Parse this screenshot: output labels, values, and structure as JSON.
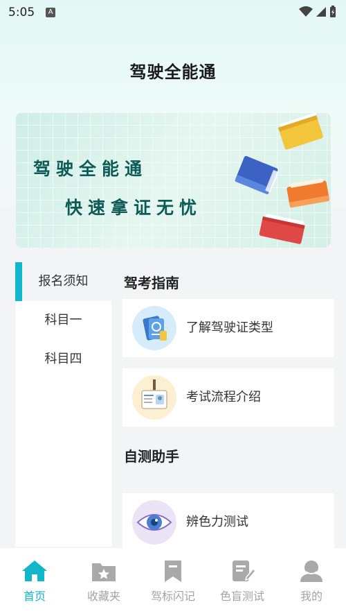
{
  "status_bar": {
    "time": "5:05",
    "notif_glyph": "A"
  },
  "header": {
    "title": "驾驶全能通"
  },
  "banner": {
    "line1": "驾驶全能通",
    "line2": "快速拿证无忧"
  },
  "categories": [
    {
      "label": "报名须知",
      "active": true
    },
    {
      "label": "科目一",
      "active": false
    },
    {
      "label": "科目四",
      "active": false
    }
  ],
  "sections": [
    {
      "title": "驾考指南",
      "cards": [
        {
          "label": "了解驾驶证类型",
          "icon": "passport-icon"
        },
        {
          "label": "考试流程介绍",
          "icon": "id-badge-icon"
        }
      ]
    },
    {
      "title": "自测助手",
      "cards": [
        {
          "label": "辨色力测试",
          "icon": "eye-icon"
        }
      ]
    }
  ],
  "tabs": [
    {
      "label": "首页",
      "icon": "home-icon",
      "active": true
    },
    {
      "label": "收藏夹",
      "icon": "folder-star-icon",
      "active": false
    },
    {
      "label": "驾标闪记",
      "icon": "bookmark-icon",
      "active": false
    },
    {
      "label": "色盲测试",
      "icon": "edit-doc-icon",
      "active": false
    },
    {
      "label": "我的",
      "icon": "user-icon",
      "active": false
    }
  ],
  "colors": {
    "accent": "#11b7c8",
    "inactive_tab": "#a3a3a3",
    "banner_text": "#0d5b56"
  }
}
